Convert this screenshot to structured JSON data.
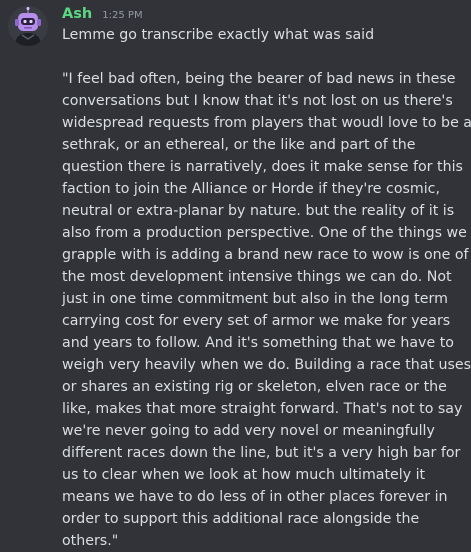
{
  "message": {
    "author": "Ash",
    "timestamp": "1:25 PM",
    "intro": "Lemme go transcribe exactly what was said",
    "quote_lines": [
      "\"I feel bad often, being the bearer of bad news in these",
      "conversations but I know that it's not lost on us there's",
      "widespread requests from players that woudl love to be a",
      "sethrak, or an ethereal, or the like and part of the",
      "question there is narratively, does it make sense for this",
      "faction to join the Alliance or Horde if they're cosmic,",
      "neutral or extra-planar by nature. but the reality of it is",
      "also from a production perspective. One of the things we",
      "grapple with is adding a brand new race to wow is one of",
      "the most development intensive things we can do. Not",
      "just in one time commitment but also in the long term",
      "carrying cost for every set of armor we make for years",
      "and years to follow. And it's something that we have to",
      "weigh very heavily when we do. Building a race that uses",
      "or shares an existing rig or skeleton, elven race or the",
      "like, makes that more straight forward. That's not to say",
      "we're never going to add very novel or meaningfully",
      "different races down the line, but it's a very high bar for",
      "us to clear when we look at how much ultimately it",
      "means we have to do less of in other places forever in",
      "order to support this additional race alongside the",
      "others.\""
    ]
  },
  "colors": {
    "background": "#313338",
    "username": "#5bd882",
    "text": "#dbdee1",
    "timestamp": "#949ba4"
  },
  "icons": {
    "avatar": "purple-robot-avatar-icon"
  }
}
